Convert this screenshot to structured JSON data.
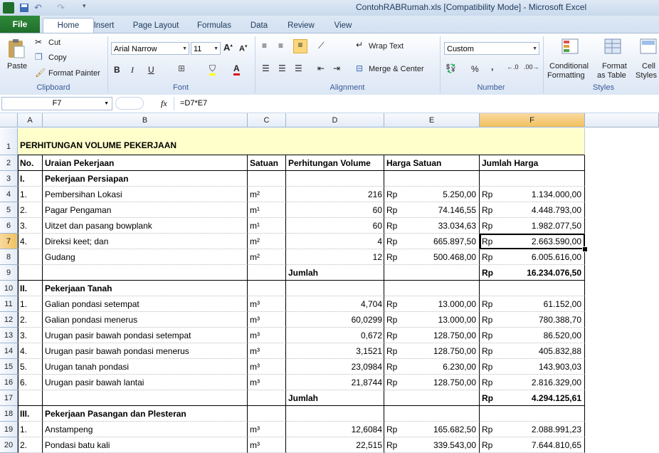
{
  "window": {
    "title": "ContohRABRumah.xls  [Compatibility Mode]  -  Microsoft Excel"
  },
  "tabs": [
    "File",
    "Home",
    "Insert",
    "Page Layout",
    "Formulas",
    "Data",
    "Review",
    "View"
  ],
  "clipboard": {
    "paste": "Paste",
    "cut": "Cut",
    "copy": "Copy",
    "format_painter": "Format Painter",
    "label": "Clipboard"
  },
  "font": {
    "name": "Arial Narrow",
    "size": "11",
    "label": "Font",
    "bold": "B",
    "italic": "I",
    "underline": "U"
  },
  "alignment": {
    "wrap": "Wrap Text",
    "merge": "Merge & Center",
    "label": "Alignment"
  },
  "number": {
    "format": "Custom",
    "label": "Number",
    "percent": "%",
    "comma": ","
  },
  "styles": {
    "conditional": "Conditional",
    "conditional2": "Formatting",
    "format_as": "Format",
    "format_as2": "as Table",
    "cell": "Cell",
    "cell2": "Styles",
    "label": "Styles"
  },
  "formula_bar": {
    "cell_ref": "F7",
    "fx": "fx",
    "formula": "=D7*E7"
  },
  "columns": [
    "A",
    "B",
    "C",
    "D",
    "E",
    "F"
  ],
  "rows": [
    {
      "n": "1",
      "a": "PERHITUNGAN VOLUME PEKERJAAN",
      "b": "",
      "c": "",
      "d": "",
      "e1": "",
      "e2": "",
      "f1": "",
      "f2": ""
    },
    {
      "n": "2",
      "a": "No.",
      "b": "Uraian Pekerjaan",
      "c": "Satuan",
      "d": "Perhitungan Volume",
      "e1": "Harga Satuan",
      "e2": "",
      "f1": "Jumlah Harga",
      "f2": ""
    },
    {
      "n": "3",
      "a": "I.",
      "b": "Pekerjaan Persiapan",
      "c": "",
      "d": "",
      "e1": "",
      "e2": "",
      "f1": "",
      "f2": ""
    },
    {
      "n": "4",
      "a": "1.",
      "b": "Pembersihan Lokasi",
      "c": "m²",
      "d": "216",
      "e1": "Rp",
      "e2": "5.250,00",
      "f1": "Rp",
      "f2": "1.134.000,00"
    },
    {
      "n": "5",
      "a": "2.",
      "b": "Pagar Pengaman",
      "c": "m¹",
      "d": "60",
      "e1": "Rp",
      "e2": "74.146,55",
      "f1": "Rp",
      "f2": "4.448.793,00"
    },
    {
      "n": "6",
      "a": "3.",
      "b": "Uitzet dan pasang bowplank",
      "c": "m¹",
      "d": "60",
      "e1": "Rp",
      "e2": "33.034,63",
      "f1": "Rp",
      "f2": "1.982.077,50"
    },
    {
      "n": "7",
      "a": "4.",
      "b": "Direksi keet; dan",
      "c": "m²",
      "d": "4",
      "e1": "Rp",
      "e2": "665.897,50",
      "f1": "Rp",
      "f2": "2.663.590,00"
    },
    {
      "n": "8",
      "a": "",
      "b": "Gudang",
      "c": "m²",
      "d": "12",
      "e1": "Rp",
      "e2": "500.468,00",
      "f1": "Rp",
      "f2": "6.005.616,00"
    },
    {
      "n": "9",
      "a": "",
      "b": "",
      "c": "",
      "d": "Jumlah",
      "e1": "",
      "e2": "",
      "f1": "Rp",
      "f2": "16.234.076,50"
    },
    {
      "n": "10",
      "a": "II.",
      "b": "Pekerjaan Tanah",
      "c": "",
      "d": "",
      "e1": "",
      "e2": "",
      "f1": "",
      "f2": ""
    },
    {
      "n": "11",
      "a": "1.",
      "b": "Galian pondasi setempat",
      "c": "m³",
      "d": "4,704",
      "e1": "Rp",
      "e2": "13.000,00",
      "f1": "Rp",
      "f2": "61.152,00"
    },
    {
      "n": "12",
      "a": "2.",
      "b": "Galian pondasi menerus",
      "c": "m³",
      "d": "60,0299",
      "e1": "Rp",
      "e2": "13.000,00",
      "f1": "Rp",
      "f2": "780.388,70"
    },
    {
      "n": "13",
      "a": "3.",
      "b": "Urugan pasir bawah pondasi setempat",
      "c": "m³",
      "d": "0,672",
      "e1": "Rp",
      "e2": "128.750,00",
      "f1": "Rp",
      "f2": "86.520,00"
    },
    {
      "n": "14",
      "a": "4.",
      "b": "Urugan pasir bawah pondasi menerus",
      "c": "m³",
      "d": "3,1521",
      "e1": "Rp",
      "e2": "128.750,00",
      "f1": "Rp",
      "f2": "405.832,88"
    },
    {
      "n": "15",
      "a": "5.",
      "b": "Urugan tanah pondasi",
      "c": "m³",
      "d": "23,0984",
      "e1": "Rp",
      "e2": "6.230,00",
      "f1": "Rp",
      "f2": "143.903,03"
    },
    {
      "n": "16",
      "a": "6.",
      "b": "Urugan pasir bawah lantai",
      "c": "m³",
      "d": "21,8744",
      "e1": "Rp",
      "e2": "128.750,00",
      "f1": "Rp",
      "f2": "2.816.329,00"
    },
    {
      "n": "17",
      "a": "",
      "b": "",
      "c": "",
      "d": "Jumlah",
      "e1": "",
      "e2": "",
      "f1": "Rp",
      "f2": "4.294.125,61"
    },
    {
      "n": "18",
      "a": "III.",
      "b": "Pekerjaan Pasangan dan Plesteran",
      "c": "",
      "d": "",
      "e1": "",
      "e2": "",
      "f1": "",
      "f2": ""
    },
    {
      "n": "19",
      "a": "1.",
      "b": "Anstampeng",
      "c": "m³",
      "d": "12,6084",
      "e1": "Rp",
      "e2": "165.682,50",
      "f1": "Rp",
      "f2": "2.088.991,23"
    },
    {
      "n": "20",
      "a": "2.",
      "b": "Pondasi batu kali",
      "c": "m³",
      "d": "22,515",
      "e1": "Rp",
      "e2": "339.543,00",
      "f1": "Rp",
      "f2": "7.644.810,65"
    }
  ],
  "colors": {
    "title_fill": "#ffffcc",
    "selection": "#f1c15f",
    "file_tab": "#2a7f35"
  }
}
